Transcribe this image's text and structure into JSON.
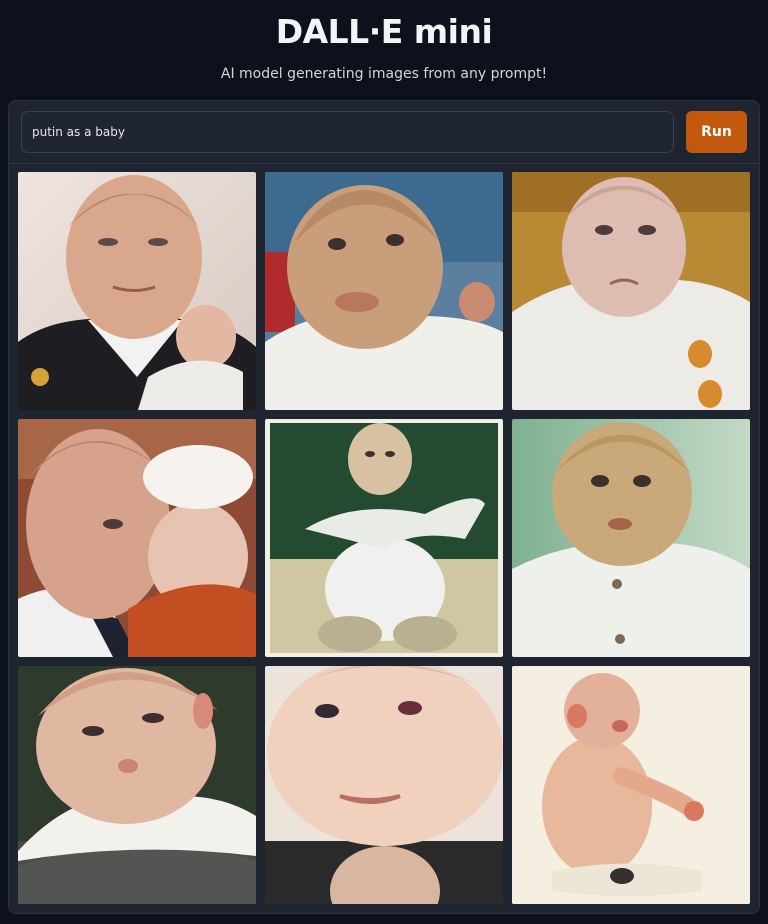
{
  "header": {
    "title": "DALL·E mini",
    "subtitle": "AI model generating images from any prompt!"
  },
  "prompt": {
    "value": "putin as a baby",
    "placeholder": ""
  },
  "run_button": {
    "label": "Run"
  },
  "colors": {
    "accent": "#c2590f",
    "background": "#0d111b",
    "panel": "#1f2431"
  },
  "images": [
    {
      "name": "generated-image-1"
    },
    {
      "name": "generated-image-2"
    },
    {
      "name": "generated-image-3"
    },
    {
      "name": "generated-image-4"
    },
    {
      "name": "generated-image-5"
    },
    {
      "name": "generated-image-6"
    },
    {
      "name": "generated-image-7"
    },
    {
      "name": "generated-image-8"
    },
    {
      "name": "generated-image-9"
    }
  ]
}
